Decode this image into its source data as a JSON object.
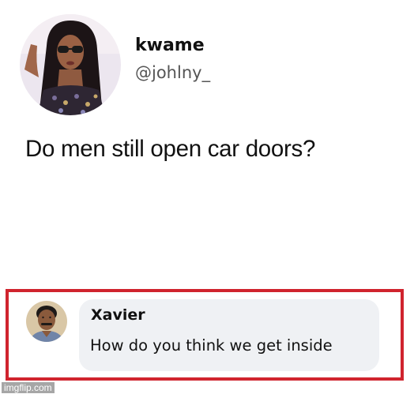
{
  "tweet": {
    "author_name": "kwame",
    "author_handle": "@johlny_",
    "text": "Do men still open car doors?",
    "avatar_icon": "profile-photo-woman"
  },
  "reply": {
    "author_name": "Xavier",
    "text": "How do you think we get inside",
    "avatar_icon": "profile-photo-man",
    "highlight_color": "#d0242e",
    "bubble_color": "#eff1f4"
  },
  "watermark": {
    "text": "imgflip.com"
  }
}
